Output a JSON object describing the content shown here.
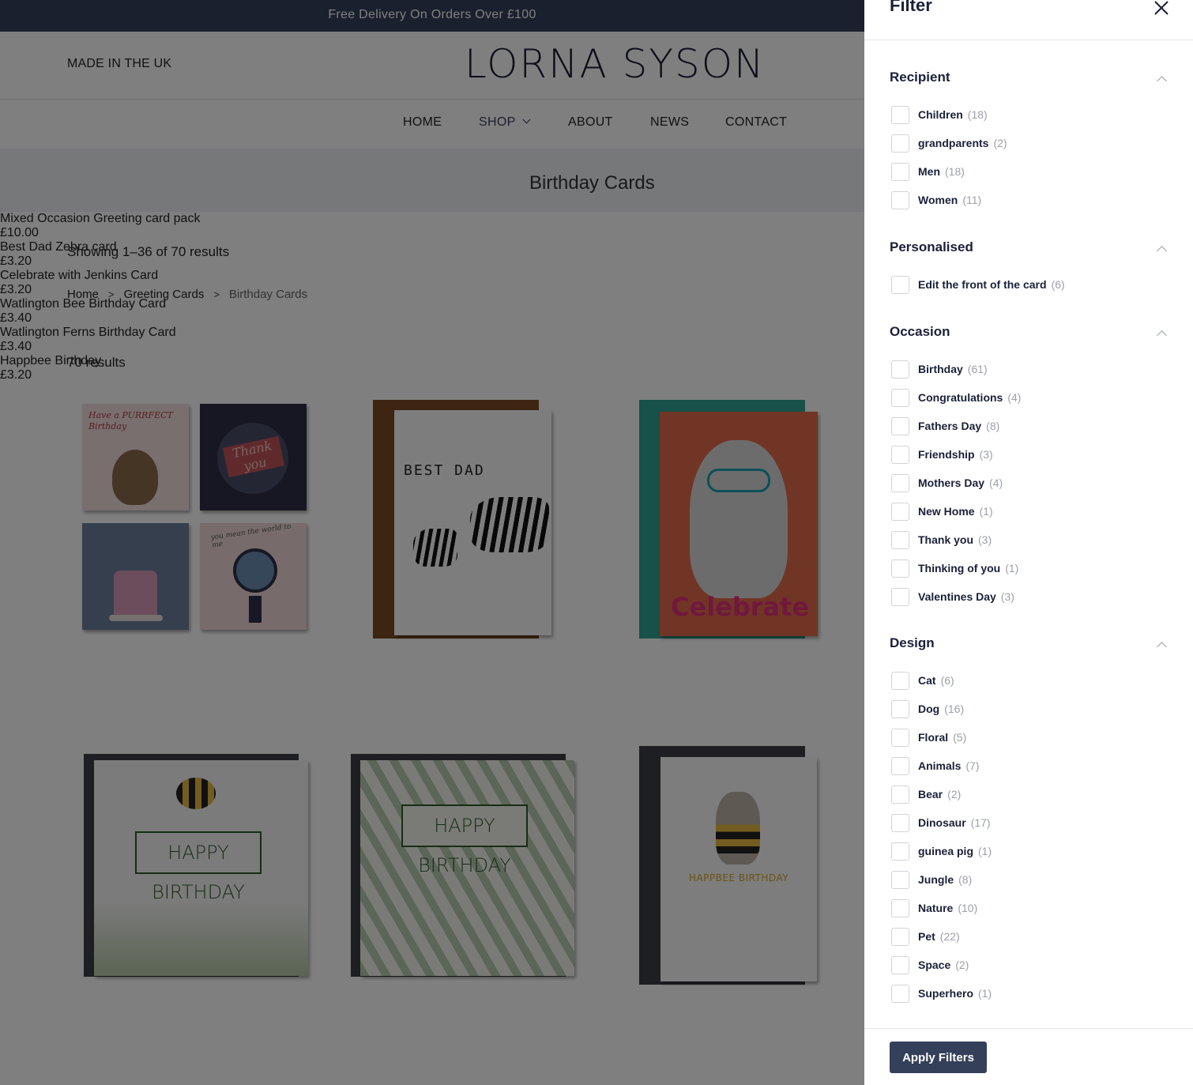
{
  "topbar": {
    "text": "Free Delivery On Orders Over £100"
  },
  "header": {
    "made_in": "MADE IN THE UK",
    "logo": "LORNA SYSON"
  },
  "nav": {
    "home": "HOME",
    "shop": "SHOP",
    "about": "ABOUT",
    "news": "NEWS",
    "contact": "CONTACT"
  },
  "hero": {
    "title": "Birthday Cards"
  },
  "listing": {
    "showing": "Showing 1–36 of 70 results",
    "results": "70 results",
    "breadcrumb": [
      "Home",
      "Greeting Cards",
      "Birthday Cards"
    ]
  },
  "products": [
    {
      "name": "Mixed Occasion Greeting card pack",
      "price": "£10.00"
    },
    {
      "name": "Best Dad Zebra card",
      "price": "£3.20",
      "card_text": "BEST DAD"
    },
    {
      "name": "Celebrate with Jenkins Card",
      "price": "£3.20",
      "card_text": "Celebrate"
    },
    {
      "name": "Watlington Bee Birthday Card",
      "price": "£3.40",
      "card_text": "HAPPY BIRTHDAY"
    },
    {
      "name": "Watlington Ferns Birthday Card",
      "price": "£3.40",
      "card_text": "HAPPY BIRTHDAY"
    },
    {
      "name": "Happbee Birthday",
      "price": "£3.20",
      "card_text": "HAPPBEE BIRTHDAY"
    }
  ],
  "pack_cards": {
    "a": "Have a PURRFECT Birthday",
    "b": "Thank you",
    "d": "you mean the world to me"
  },
  "filter": {
    "title": "Filter",
    "apply_label": "Apply Filters",
    "sections": [
      {
        "title": "Recipient",
        "options": [
          {
            "label": "Children",
            "count": "(18)"
          },
          {
            "label": "grandparents",
            "count": "(2)"
          },
          {
            "label": "Men",
            "count": "(18)"
          },
          {
            "label": "Women",
            "count": "(11)"
          }
        ]
      },
      {
        "title": "Personalised",
        "options": [
          {
            "label": "Edit the front of the card",
            "count": "(6)"
          }
        ]
      },
      {
        "title": "Occasion",
        "options": [
          {
            "label": "Birthday",
            "count": "(61)"
          },
          {
            "label": "Congratulations",
            "count": "(4)"
          },
          {
            "label": "Fathers Day",
            "count": "(8)"
          },
          {
            "label": "Friendship",
            "count": "(3)"
          },
          {
            "label": "Mothers Day",
            "count": "(4)"
          },
          {
            "label": "New Home",
            "count": "(1)"
          },
          {
            "label": "Thank you",
            "count": "(3)"
          },
          {
            "label": "Thinking of you",
            "count": "(1)"
          },
          {
            "label": "Valentines Day",
            "count": "(3)"
          }
        ]
      },
      {
        "title": "Design",
        "options": [
          {
            "label": "Cat",
            "count": "(6)"
          },
          {
            "label": "Dog",
            "count": "(16)"
          },
          {
            "label": "Floral",
            "count": "(5)"
          },
          {
            "label": "Animals",
            "count": "(7)"
          },
          {
            "label": "Bear",
            "count": "(2)"
          },
          {
            "label": "Dinosaur",
            "count": "(17)"
          },
          {
            "label": "guinea pig",
            "count": "(1)"
          },
          {
            "label": "Jungle",
            "count": "(8)"
          },
          {
            "label": "Nature",
            "count": "(10)"
          },
          {
            "label": "Pet",
            "count": "(22)"
          },
          {
            "label": "Space",
            "count": "(2)"
          },
          {
            "label": "Superhero",
            "count": "(1)"
          }
        ]
      }
    ]
  },
  "colors": {
    "brand": "#34405a",
    "overlay": "#000000"
  }
}
